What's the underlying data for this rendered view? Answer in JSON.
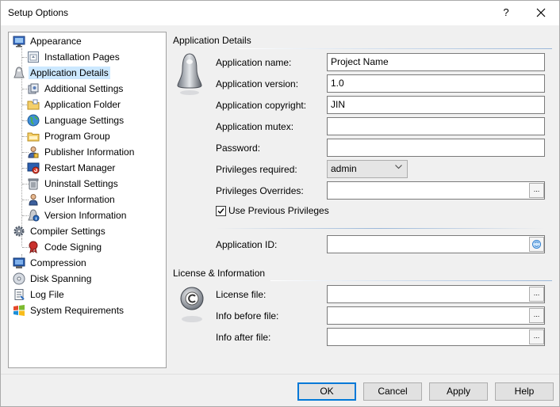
{
  "window": {
    "title": "Setup Options",
    "help_glyph": "?"
  },
  "tree": {
    "items": [
      {
        "label": "Appearance",
        "icon": "monitor-icon"
      },
      {
        "label": "Installation Pages",
        "icon": "page-icon"
      },
      {
        "label": "Application Details",
        "icon": "application-icon",
        "selected": true
      },
      {
        "label": "Additional Settings",
        "icon": "settings-icon"
      },
      {
        "label": "Application Folder",
        "icon": "folder-icon"
      },
      {
        "label": "Language Settings",
        "icon": "globe-icon"
      },
      {
        "label": "Program Group",
        "icon": "program-group-icon"
      },
      {
        "label": "Publisher Information",
        "icon": "publisher-icon"
      },
      {
        "label": "Restart Manager",
        "icon": "restart-icon"
      },
      {
        "label": "Uninstall Settings",
        "icon": "uninstall-icon"
      },
      {
        "label": "User Information",
        "icon": "user-icon"
      },
      {
        "label": "Version Information",
        "icon": "version-icon"
      },
      {
        "label": "Compiler Settings",
        "icon": "gear-icon"
      },
      {
        "label": "Code Signing",
        "icon": "seal-icon"
      },
      {
        "label": "Compression",
        "icon": "compression-icon"
      },
      {
        "label": "Disk Spanning",
        "icon": "disk-icon"
      },
      {
        "label": "Log File",
        "icon": "log-icon"
      },
      {
        "label": "System Requirements",
        "icon": "windows-icon"
      }
    ]
  },
  "application_details": {
    "section_title": "Application Details",
    "name_label": "Application name:",
    "name_value": "Project Name",
    "version_label": "Application version:",
    "version_value": "1.0",
    "copyright_label": "Application copyright:",
    "copyright_value": "JIN",
    "mutex_label": "Application mutex:",
    "mutex_value": "",
    "password_label": "Password:",
    "password_value": "",
    "privileges_label": "Privileges required:",
    "privileges_value": "admin",
    "overrides_label": "Privileges Overrides:",
    "overrides_value": "",
    "browse_glyph": "...",
    "use_previous_label": "Use Previous Privileges",
    "use_previous_checked": true,
    "app_id_label": "Application ID:",
    "app_id_value": ""
  },
  "license": {
    "section_title": "License & Information",
    "license_label": "License file:",
    "license_value": "",
    "info_before_label": "Info before file:",
    "info_before_value": "",
    "info_after_label": "Info after file:",
    "info_after_value": ""
  },
  "buttons": {
    "ok": "OK",
    "cancel": "Cancel",
    "apply": "Apply",
    "help": "Help"
  },
  "colors": {
    "accent": "#0078d7",
    "selection": "#cce8ff",
    "separator": "#9ab7d9"
  }
}
